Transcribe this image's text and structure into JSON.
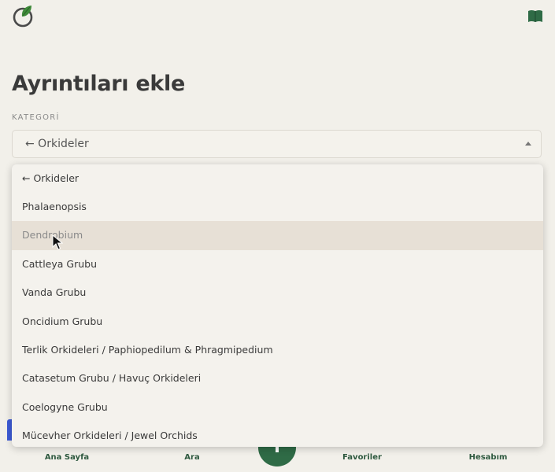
{
  "page": {
    "title": "Ayrıntıları ekle"
  },
  "form": {
    "category_label": "KATEGORİ",
    "category_value": "← Orkideler"
  },
  "dropdown": {
    "options": [
      "← Orkideler",
      "Phalaenopsis",
      "Dendrobium",
      "Cattleya Grubu",
      "Vanda Grubu",
      "Oncidium Grubu",
      "Terlik Orkideleri / Paphiopedilum & Phragmipedium",
      "Catasetum Grubu / Havuç Orkideleri",
      "Coelogyne Grubu",
      "Mücevher Orkideleri / Jewel Orchids"
    ],
    "hovered_option": "Dendrobium"
  },
  "bottom_nav": {
    "home": "Ana Sayfa",
    "search": "Ara",
    "favorites": "Favoriler",
    "account": "Hesabım"
  },
  "colors": {
    "brand_green": "#2f6b46",
    "background": "#f2f0ea",
    "hover_row": "#e7e0d6"
  },
  "icons": {
    "logo": "leaf-ring-logo",
    "guide": "book-icon",
    "add": "plus-icon",
    "select": "caret-up-icon"
  }
}
